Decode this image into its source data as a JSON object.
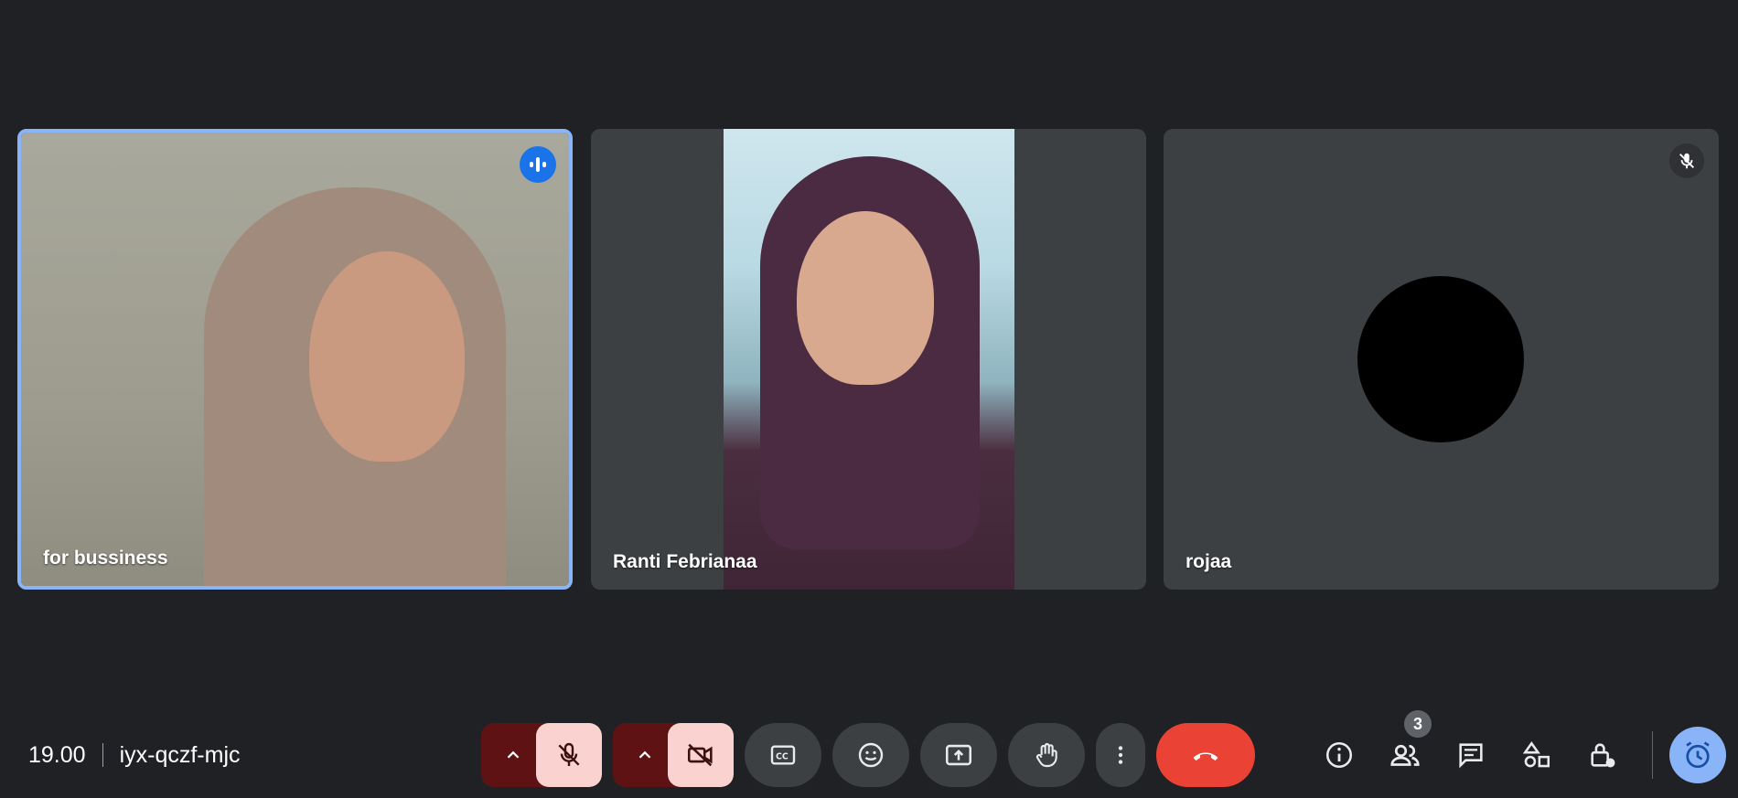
{
  "tiles": [
    {
      "name": "for bussiness",
      "active": true,
      "speaking": true
    },
    {
      "name": "Ranti Febrianaa",
      "active": false
    },
    {
      "name": "rojaa",
      "active": false,
      "muted": true
    }
  ],
  "meeting": {
    "time": "19.00",
    "code": "iyx-qczf-mjc"
  },
  "people_count": "3",
  "colors": {
    "background": "#202124",
    "active_border": "#8ab4f8",
    "end_call": "#ea4335",
    "muted_bg": "#fad2cf",
    "muted_dark": "#5e1213"
  }
}
